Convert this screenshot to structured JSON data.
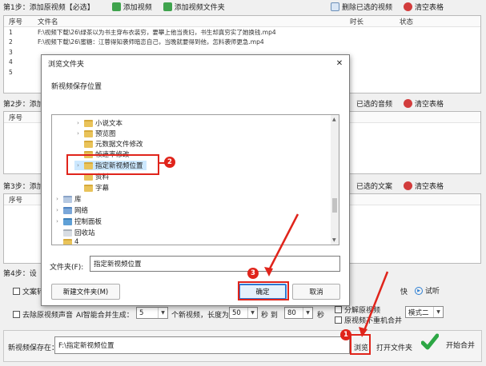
{
  "step1": {
    "label": "第1步：添加原视频【必选】",
    "add_video": "添加视频",
    "add_folder": "添加视频文件夹",
    "delete_done": "删除已选的视频",
    "clear": "清空表格"
  },
  "table": {
    "col_index": "序号",
    "col_name": "文件名",
    "col_duration": "时长",
    "col_status": "状态",
    "rows": [
      {
        "idx": "1",
        "name": "F:\\视频下载\\26\\绿茶以为书主穿布衣装穷，要攀上他当贵妇，书生却真穷实了她换钱.mp4"
      },
      {
        "idx": "2",
        "name": "F:\\视频下载\\26\\蜜糖：江蓉得知袭师暗恋自己，当晚就要得到他，怎料袭师更急.mp4"
      },
      {
        "idx": "3",
        "name": ""
      },
      {
        "idx": "4",
        "name": ""
      },
      {
        "idx": "5",
        "name": ""
      }
    ]
  },
  "step2": {
    "label": "第2步：添加",
    "delete_done": "已选的音频",
    "clear": "清空表格"
  },
  "table2": {
    "col_index": "序号"
  },
  "step3": {
    "label": "第3步：添加",
    "delete_done": "已选的文案",
    "clear": "清空表格"
  },
  "table3": {
    "col_index": "序号"
  },
  "step4": {
    "label": "第4步：设"
  },
  "options": {
    "text_convert": "文案转",
    "speed_suffix": "快",
    "preview": "试听",
    "remove_audio": "去除原视频声音",
    "ai_label": "AI智能合并生成：",
    "ai_count": "5",
    "per_video_label": "个新视频，长度为：",
    "len_min": "50",
    "to_label": "秒 到",
    "len_max": "80",
    "sec_label": "秒",
    "split_video": "分解原视频",
    "no_repeat": "原视频不重机合并",
    "mode": "模式二"
  },
  "save": {
    "label": "新视频保存在：",
    "path": "F:\\指定新视频位置",
    "browse": "浏览",
    "open_folder": "打开文件夹",
    "merge": "开始合并"
  },
  "dialog": {
    "title": "浏览文件夹",
    "subtitle": "新视频保存位置",
    "tree": [
      "小说文本",
      "预览图",
      "元数据文件修改",
      "帧速率修改",
      "指定新视频位置",
      "资料",
      "字幕",
      "库",
      "网络",
      "控制面板",
      "回收站",
      "4"
    ],
    "folder_label": "文件夹(F):",
    "folder_value": "指定新视频位置",
    "new_folder": "新建文件夹(M)",
    "ok": "确定",
    "cancel": "取消",
    "close": "✕"
  },
  "annotations": {
    "b1": "1",
    "b2": "2",
    "b3": "3"
  },
  "colors": {
    "accent": "#e0241b",
    "selection": "#cce8ff",
    "window_bg": "#f0f0f0"
  }
}
